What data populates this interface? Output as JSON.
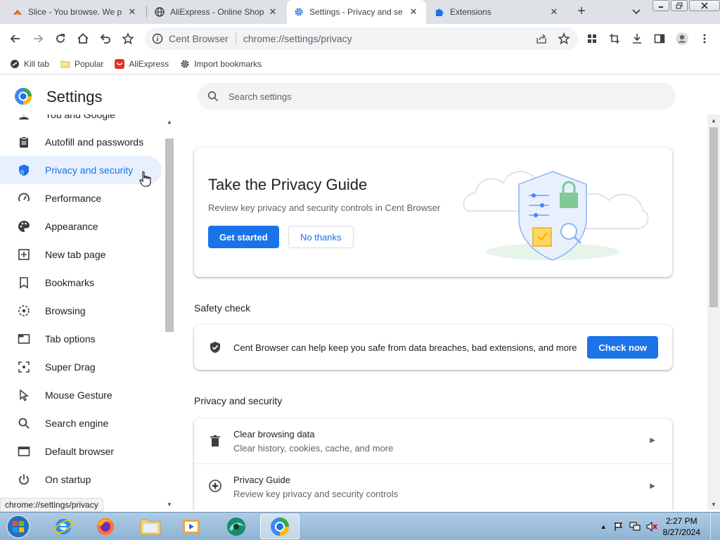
{
  "tabs": [
    {
      "title": "Slice - You browse. We p",
      "icon": "slice-icon"
    },
    {
      "title": "AliExpress - Online Shop",
      "icon": "globe-icon"
    },
    {
      "title": "Settings - Privacy and se",
      "icon": "gear-icon"
    },
    {
      "title": "Extensions",
      "icon": "puzzle-icon"
    }
  ],
  "toolbar": {
    "site_name": "Cent Browser",
    "url": "chrome://settings/privacy"
  },
  "bookmarks": [
    {
      "label": "Kill tab",
      "icon": "kill-tab-icon"
    },
    {
      "label": "Popular",
      "icon": "folder-icon"
    },
    {
      "label": "AliExpress",
      "icon": "aliexpress-icon"
    },
    {
      "label": "Import bookmarks",
      "icon": "gear-icon"
    }
  ],
  "settings": {
    "title": "Settings",
    "search_placeholder": "Search settings"
  },
  "sidebar": {
    "items": [
      {
        "label": "You and Google",
        "icon": "person-icon"
      },
      {
        "label": "Autofill and passwords",
        "icon": "clipboard-icon"
      },
      {
        "label": "Privacy and security",
        "icon": "shield-icon",
        "active": true
      },
      {
        "label": "Performance",
        "icon": "speedometer-icon"
      },
      {
        "label": "Appearance",
        "icon": "palette-icon"
      },
      {
        "label": "New tab page",
        "icon": "new-tab-icon"
      },
      {
        "label": "Bookmarks",
        "icon": "bookmark-icon"
      },
      {
        "label": "Browsing",
        "icon": "browsing-icon"
      },
      {
        "label": "Tab options",
        "icon": "tab-icon"
      },
      {
        "label": "Super Drag",
        "icon": "drag-icon"
      },
      {
        "label": "Mouse Gesture",
        "icon": "cursor-icon"
      },
      {
        "label": "Search engine",
        "icon": "search-icon"
      },
      {
        "label": "Default browser",
        "icon": "browser-window-icon"
      },
      {
        "label": "On startup",
        "icon": "power-icon"
      }
    ]
  },
  "privacy_guide": {
    "title": "Take the Privacy Guide",
    "description": "Review key privacy and security controls in Cent Browser",
    "get_started": "Get started",
    "no_thanks": "No thanks"
  },
  "safety_check": {
    "heading": "Safety check",
    "text": "Cent Browser can help keep you safe from data breaches, bad extensions, and more",
    "button": "Check now"
  },
  "privacy_section": {
    "heading": "Privacy and security",
    "rows": [
      {
        "title": "Clear browsing data",
        "subtitle": "Clear history, cookies, cache, and more",
        "icon": "trash-icon"
      },
      {
        "title": "Privacy Guide",
        "subtitle": "Review key privacy and security controls",
        "icon": "compass-icon"
      }
    ]
  },
  "status_bar": {
    "url": "chrome://settings/privacy"
  },
  "taskbar": {
    "time": "2:27 PM",
    "date": "8/27/2024"
  },
  "colors": {
    "accent": "#1a73e8",
    "active_nav_bg": "#e8f0fe",
    "tab_strip": "#dee1e6"
  }
}
